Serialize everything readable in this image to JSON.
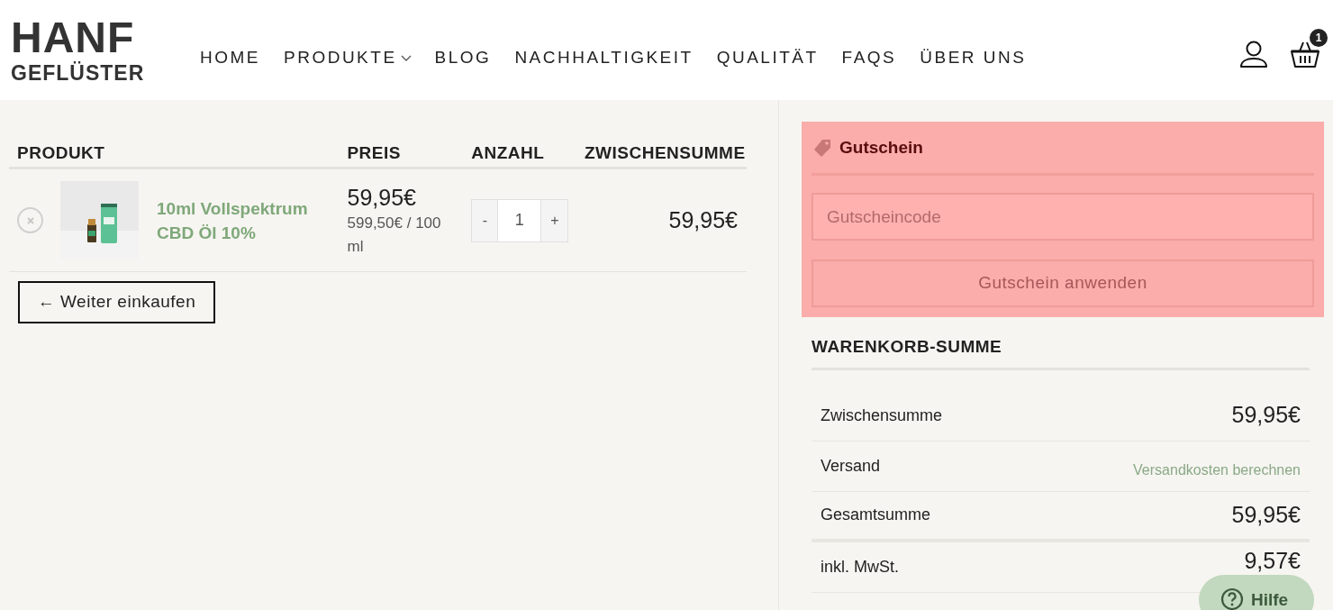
{
  "logo": {
    "line_1": "HANF",
    "line_2": "GEFLÜSTER"
  },
  "nav": [
    {
      "label": "HOME",
      "has_dropdown": false
    },
    {
      "label": "PRODUKTE",
      "has_dropdown": true
    },
    {
      "label": "BLOG",
      "has_dropdown": false
    },
    {
      "label": "NACHHALTIGKEIT",
      "has_dropdown": false
    },
    {
      "label": "QUALITÄT",
      "has_dropdown": false
    },
    {
      "label": "FAQS",
      "has_dropdown": false
    },
    {
      "label": "ÜBER UNS",
      "has_dropdown": false
    }
  ],
  "cart_badge": "1",
  "cart_table": {
    "columns": [
      "PRODUKT",
      "PREIS",
      "ANZAHL",
      "ZWISCHENSUMME"
    ],
    "rows": [
      {
        "product": "10ml Vollspektrum CBD Öl 10%",
        "price": "59,95€",
        "unit_price": "599,50€ / 100 ml",
        "quantity": "1",
        "minus": "-",
        "plus": "+",
        "subtotal": "59,95€"
      }
    ]
  },
  "continue_button": "← Weiter einkaufen",
  "coupon": {
    "title": "Gutschein",
    "placeholder": "Gutscheincode",
    "button": "Gutschein anwenden"
  },
  "totals": {
    "title": "WARENKORB-SUMME",
    "rows": [
      {
        "label": "Zwischensumme",
        "value": "59,95€",
        "kind": "amount"
      },
      {
        "label": "Versand",
        "value": "Versandkosten berechnen",
        "kind": "link"
      },
      {
        "label": "Gesamtsumme",
        "value": "59,95€",
        "kind": "amount"
      },
      {
        "label": "inkl. MwSt.",
        "value": "9,57€",
        "kind": "amount"
      }
    ]
  },
  "help_button": "Hilfe"
}
